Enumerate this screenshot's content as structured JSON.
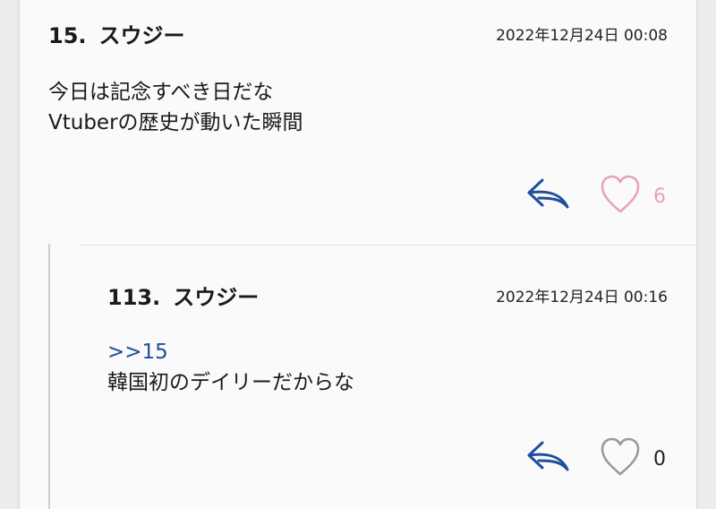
{
  "posts": [
    {
      "number": "15.",
      "author": "スウジー",
      "date": "2022年12月24日 00:08",
      "lines": [
        "今日は記念すべき日だな",
        "Vtuberの歴史が動いた瞬間"
      ],
      "like_count": "6",
      "like_color": "#e8a3b8"
    },
    {
      "number": "113.",
      "author": "スウジー",
      "date": "2022年12月24日 00:16",
      "reply_ref": ">>15",
      "lines": [
        "韓国初のデイリーだからな"
      ],
      "like_count": "0",
      "like_color": "#9a9a9a"
    }
  ],
  "colors": {
    "accent": "#1f4e9a",
    "liked": "#e8a3b8",
    "neutral": "#9a9a9a"
  },
  "icons": {
    "reply": "reply-arrow-icon",
    "like": "heart-icon"
  }
}
